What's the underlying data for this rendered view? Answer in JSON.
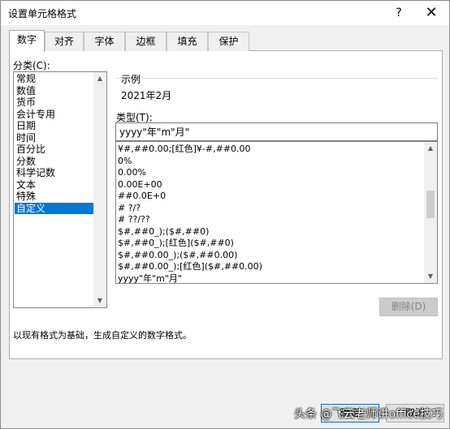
{
  "dialog": {
    "title": "设置单元格格式",
    "help_glyph": "?",
    "close_glyph": "✕"
  },
  "tabs": [
    "数字",
    "对齐",
    "字体",
    "边框",
    "填充",
    "保护"
  ],
  "active_tab": "数字",
  "category": {
    "label": "分类(C):",
    "items": [
      "常规",
      "数值",
      "货币",
      "会计专用",
      "日期",
      "时间",
      "百分比",
      "分数",
      "科学记数",
      "文本",
      "特殊",
      "自定义"
    ],
    "selected": "自定义"
  },
  "sample": {
    "label": "示例",
    "value": "2021年2月"
  },
  "type": {
    "label": "类型(T):",
    "value": "yyyy\"年\"m\"月\""
  },
  "formats": [
    "¥#,##0.00;[红色]¥-#,##0.00",
    "0%",
    "0.00%",
    "0.00E+00",
    "##0.0E+0",
    "# ?/?",
    "# ??/??",
    "$#,##0_);($#,##0)",
    "$#,##0_);[红色]($#,##0)",
    "$#,##0.00_);($#,##0.00)",
    "$#,##0.00_);[红色]($#,##0.00)",
    "yyyy\"年\"m\"月\""
  ],
  "delete_button": "删除(D)",
  "description": "以现有格式为基础，生成自定义的数字格式。",
  "footer": {
    "ok_label": "确定",
    "cancel_label": "取消"
  },
  "watermark": "头条 @飞云老师讲office技巧",
  "colors": {
    "selection": "#0078d7",
    "dialog_bg": "#f0f0f0"
  }
}
